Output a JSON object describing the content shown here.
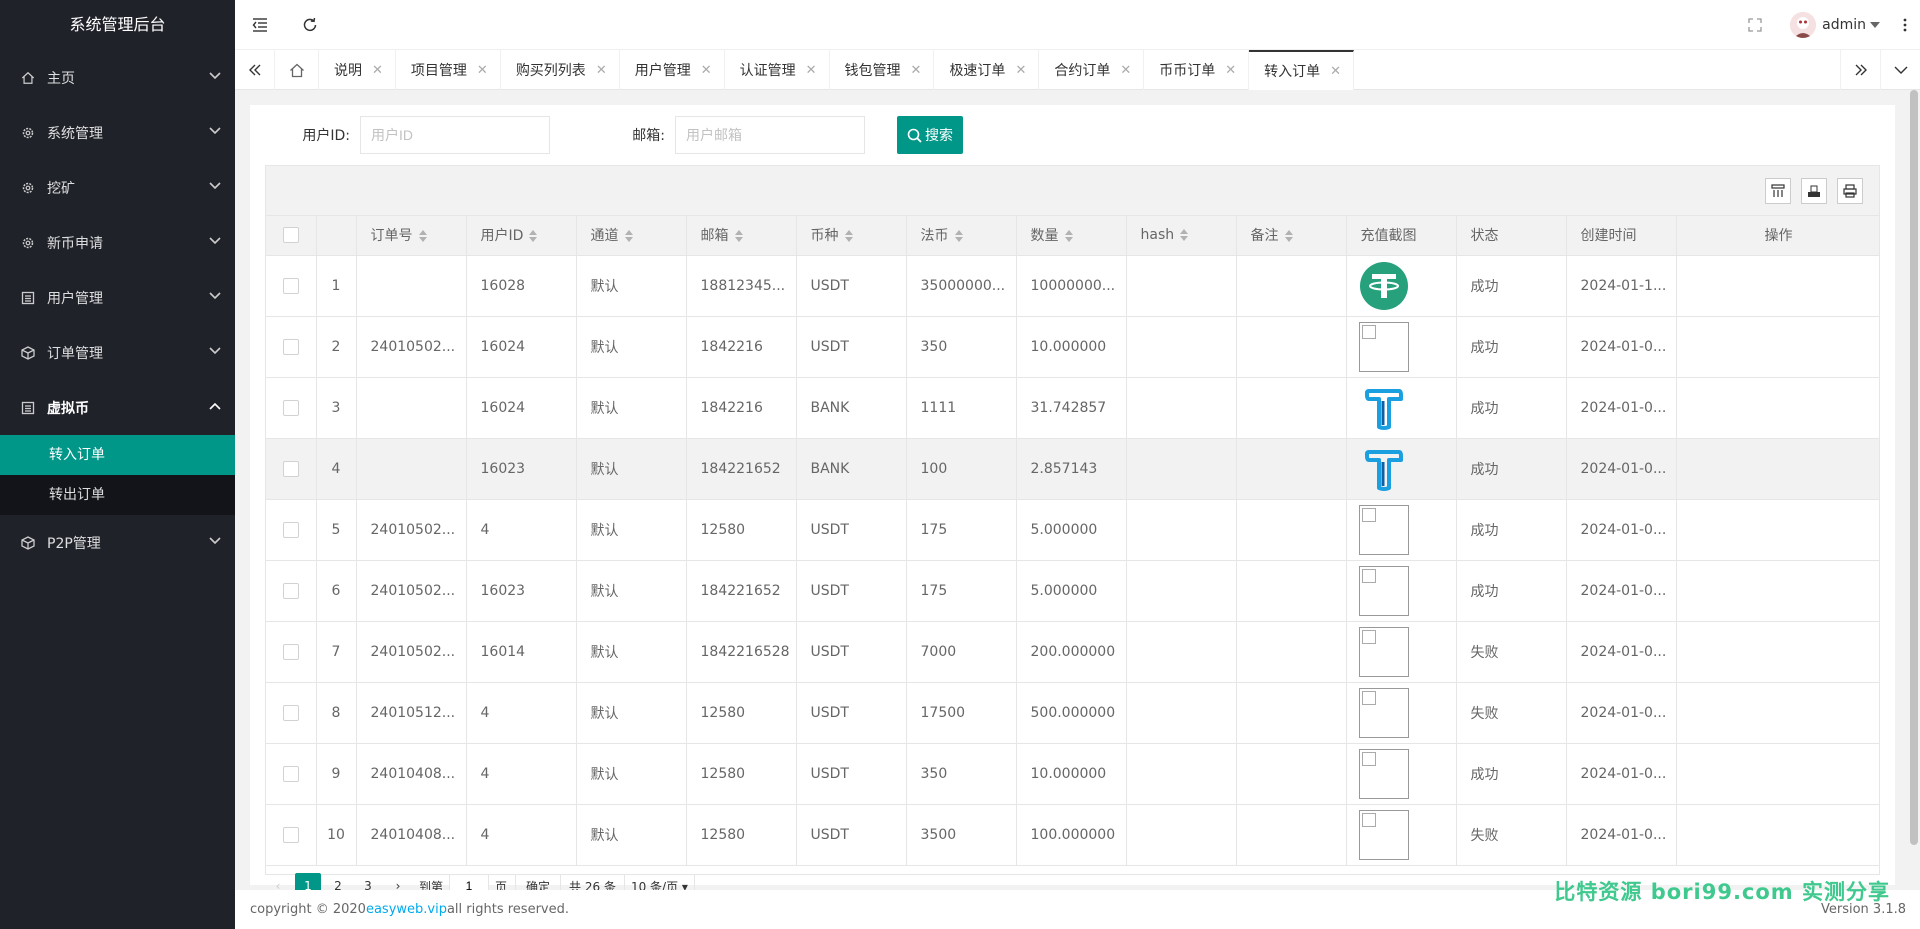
{
  "app": {
    "title": "系统管理后台"
  },
  "sidebar": {
    "items": [
      {
        "label": "主页",
        "icon": "home-icon"
      },
      {
        "label": "系统管理",
        "icon": "gear-icon"
      },
      {
        "label": "挖矿",
        "icon": "gear-icon"
      },
      {
        "label": "新币申请",
        "icon": "gear-icon"
      },
      {
        "label": "用户管理",
        "icon": "list-icon"
      },
      {
        "label": "订单管理",
        "icon": "cube-icon"
      },
      {
        "label": "虚拟币",
        "icon": "list-icon"
      },
      {
        "label": "P2P管理",
        "icon": "cube-icon"
      }
    ],
    "sub_items": [
      {
        "label": "转入订单",
        "active": true
      },
      {
        "label": "转出订单",
        "active": false
      }
    ]
  },
  "header": {
    "username": "admin"
  },
  "tabs": [
    {
      "label": "说明"
    },
    {
      "label": "项目管理"
    },
    {
      "label": "购买列列表"
    },
    {
      "label": "用户管理"
    },
    {
      "label": "认证管理"
    },
    {
      "label": "钱包管理"
    },
    {
      "label": "极速订单"
    },
    {
      "label": "合约订单"
    },
    {
      "label": "币币订单"
    },
    {
      "label": "转入订单"
    }
  ],
  "search": {
    "user_id_label": "用户ID:",
    "user_id_placeholder": "用户ID",
    "email_label": "邮箱:",
    "email_placeholder": "用户邮箱",
    "button": "搜索"
  },
  "table": {
    "columns": [
      "订单号",
      "用户ID",
      "通道",
      "邮箱",
      "币种",
      "法币",
      "数量",
      "hash",
      "备注",
      "充值截图",
      "状态",
      "创建时间",
      "操作"
    ],
    "rows": [
      {
        "no": "1",
        "order": "",
        "uid": "16028",
        "channel": "默认",
        "email": "18812345...",
        "coin": "USDT",
        "fiat": "35000000...",
        "qty": "10000000...",
        "hash": "",
        "note": "",
        "img": "tether-green",
        "status": "成功",
        "time": "2024-01-1..."
      },
      {
        "no": "2",
        "order": "24010502...",
        "uid": "16024",
        "channel": "默认",
        "email": "1842216",
        "coin": "USDT",
        "fiat": "350",
        "qty": "10.000000",
        "hash": "",
        "note": "",
        "img": "broken",
        "status": "成功",
        "time": "2024-01-0..."
      },
      {
        "no": "3",
        "order": "",
        "uid": "16024",
        "channel": "默认",
        "email": "1842216",
        "coin": "BANK",
        "fiat": "1111",
        "qty": "31.742857",
        "hash": "",
        "note": "",
        "img": "t-blue",
        "status": "成功",
        "time": "2024-01-0..."
      },
      {
        "no": "4",
        "order": "",
        "uid": "16023",
        "channel": "默认",
        "email": "184221652",
        "coin": "BANK",
        "fiat": "100",
        "qty": "2.857143",
        "hash": "",
        "note": "",
        "img": "t-blue",
        "status": "成功",
        "time": "2024-01-0..."
      },
      {
        "no": "5",
        "order": "24010502...",
        "uid": "4",
        "channel": "默认",
        "email": "12580",
        "coin": "USDT",
        "fiat": "175",
        "qty": "5.000000",
        "hash": "",
        "note": "",
        "img": "broken",
        "status": "成功",
        "time": "2024-01-0..."
      },
      {
        "no": "6",
        "order": "24010502...",
        "uid": "16023",
        "channel": "默认",
        "email": "184221652",
        "coin": "USDT",
        "fiat": "175",
        "qty": "5.000000",
        "hash": "",
        "note": "",
        "img": "broken",
        "status": "成功",
        "time": "2024-01-0..."
      },
      {
        "no": "7",
        "order": "24010502...",
        "uid": "16014",
        "channel": "默认",
        "email": "1842216528",
        "coin": "USDT",
        "fiat": "7000",
        "qty": "200.000000",
        "hash": "",
        "note": "",
        "img": "broken",
        "status": "失败",
        "time": "2024-01-0..."
      },
      {
        "no": "8",
        "order": "24010512...",
        "uid": "4",
        "channel": "默认",
        "email": "12580",
        "coin": "USDT",
        "fiat": "17500",
        "qty": "500.000000",
        "hash": "",
        "note": "",
        "img": "broken",
        "status": "失败",
        "time": "2024-01-0..."
      },
      {
        "no": "9",
        "order": "24010408...",
        "uid": "4",
        "channel": "默认",
        "email": "12580",
        "coin": "USDT",
        "fiat": "350",
        "qty": "10.000000",
        "hash": "",
        "note": "",
        "img": "broken",
        "status": "成功",
        "time": "2024-01-0..."
      },
      {
        "no": "10",
        "order": "24010408...",
        "uid": "4",
        "channel": "默认",
        "email": "12580",
        "coin": "USDT",
        "fiat": "3500",
        "qty": "100.000000",
        "hash": "",
        "note": "",
        "img": "broken",
        "status": "失败",
        "time": "2024-01-0..."
      }
    ]
  },
  "pager": {
    "pages": [
      "1",
      "2",
      "3"
    ],
    "goto_label": "到第",
    "goto_value": "1",
    "page_unit": "页",
    "confirm": "确定",
    "total": "共 26 条",
    "size_option": "10 条/页"
  },
  "footer": {
    "text_before": "copyright © 2020 ",
    "link": "easyweb.vip",
    "text_after": " all rights reserved.",
    "version": "Version 3.1.8",
    "watermark": "比特资源 bori99.com 实测分享"
  },
  "colors": {
    "accent": "#009688",
    "sidebar_bg": "#20222a",
    "tether_green": "#26a17b",
    "t_blue": "#1a9fe0"
  }
}
